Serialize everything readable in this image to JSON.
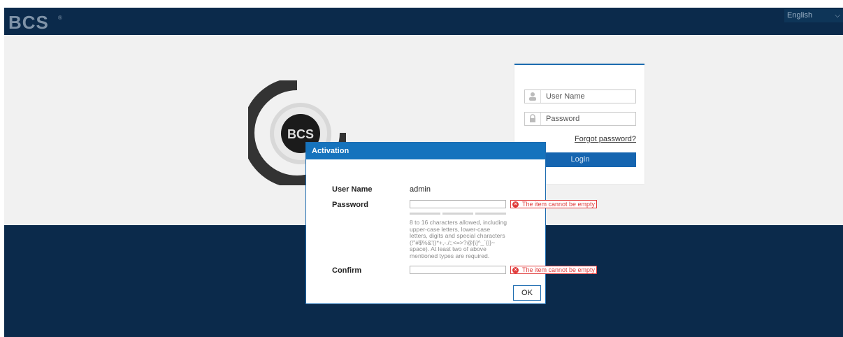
{
  "header": {
    "logo_text": "BCS",
    "language": "English"
  },
  "login": {
    "username_placeholder": "User Name",
    "password_placeholder": "Password",
    "forgot_label": "Forgot password?",
    "login_label": "Login"
  },
  "dialog": {
    "title": "Activation",
    "username_label": "User Name",
    "username_value": "admin",
    "password_label": "Password",
    "confirm_label": "Confirm",
    "password_error": "The item cannot be empty",
    "confirm_error": "The item cannot be empty",
    "hint": "8 to 16 characters allowed, including upper-case letters, lower-case letters, digits and special characters (!\"#$%&'()*+,-./:;<=>?@[\\]^_`{|}~ space). At least two of above mentioned types are required.",
    "ok_label": "OK"
  },
  "colors": {
    "header_bg": "#0b2a4b",
    "accent": "#1573bd",
    "error": "#e03b3b"
  }
}
